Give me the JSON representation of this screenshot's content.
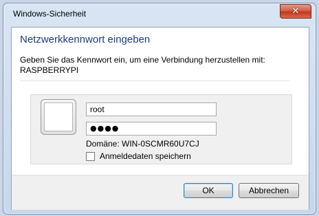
{
  "window": {
    "title": "Windows-Sicherheit",
    "close_label": "✕"
  },
  "header": {
    "title": "Netzwerkkennwort eingeben",
    "subtitle": "Geben Sie das Kennwort ein, um eine Verbindung herzustellen mit:",
    "target": "RASPBERRYPI"
  },
  "credentials": {
    "username": "root",
    "password_masked": "●●●●",
    "domain": "Domäne: WIN-0SCMR60U7CJ",
    "remember_label": "Anmeldedaten speichern",
    "remember_checked": false
  },
  "buttons": {
    "ok": "OK",
    "cancel": "Abbrechen"
  },
  "icons": {
    "avatar": "user-tile-icon",
    "close": "close-icon"
  },
  "colors": {
    "header_title": "#1e3b8a",
    "close_button": "#c0371f"
  }
}
